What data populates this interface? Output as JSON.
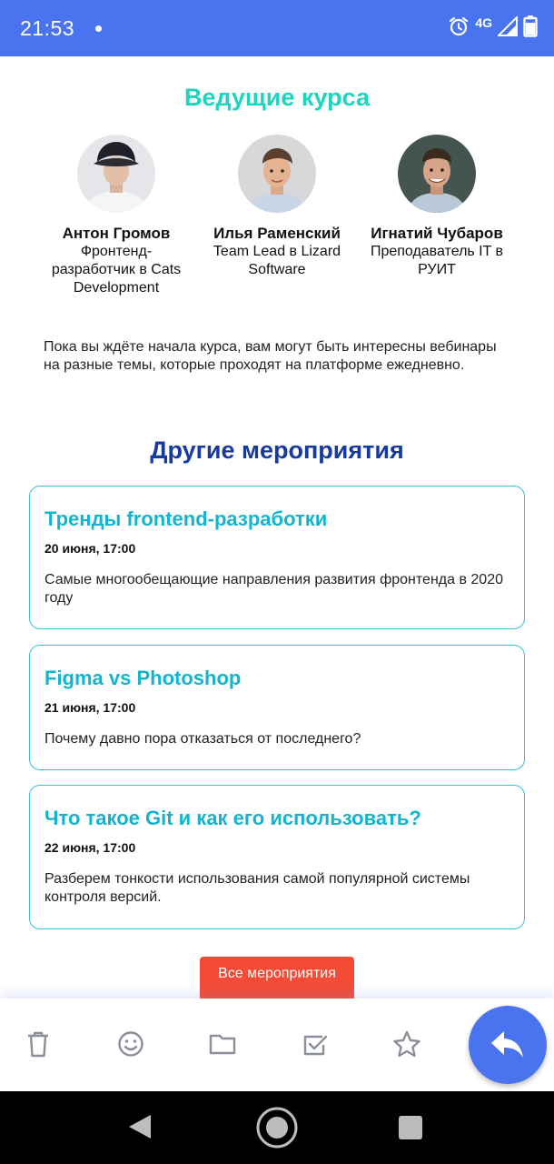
{
  "status_bar": {
    "time": "21:53",
    "network": "4G"
  },
  "speakers_section": {
    "title": "Ведущие курса",
    "speakers": [
      {
        "name": "Антон Громов",
        "role": "Фронтенд-разработчик в Cats Development"
      },
      {
        "name": "Илья Раменский",
        "role": "Team Lead в Lizard Software"
      },
      {
        "name": "Игнатий Чубаров",
        "role": "Преподаватель IT в РУИТ"
      }
    ]
  },
  "intro_text": "Пока вы ждёте начала курса, вам могут быть интересны вебинары на разные темы, которые проходят на платформе ежедневно.",
  "events_section": {
    "title": "Другие мероприятия",
    "events": [
      {
        "title": "Тренды frontend-разработки",
        "date": "20 июня, 17:00",
        "description": "Самые многообещающие направления развития фронтенда в 2020 году"
      },
      {
        "title": "Figma vs Photoshop",
        "date": "21 июня, 17:00",
        "description": "Почему давно пора отказаться от последнего?"
      },
      {
        "title": "Что такое Git и как его использовать?",
        "date": "22 июня, 17:00",
        "description": "Разберем тонкости использования самой популярной системы контроля версий."
      }
    ],
    "all_button": "Все мероприятия"
  },
  "toolbar": {
    "icons": [
      "trash-icon",
      "smiley-icon",
      "folder-icon",
      "mark-done-icon",
      "star-icon"
    ],
    "fab_icon": "reply-icon"
  },
  "colors": {
    "status_bar": "#4a73f0",
    "speakers_title": "#1fd3c1",
    "events_title": "#173a9e",
    "event_title": "#14b4cf",
    "event_border": "#35c3d6",
    "button": "#f44b37",
    "fab": "#4a73f0"
  }
}
